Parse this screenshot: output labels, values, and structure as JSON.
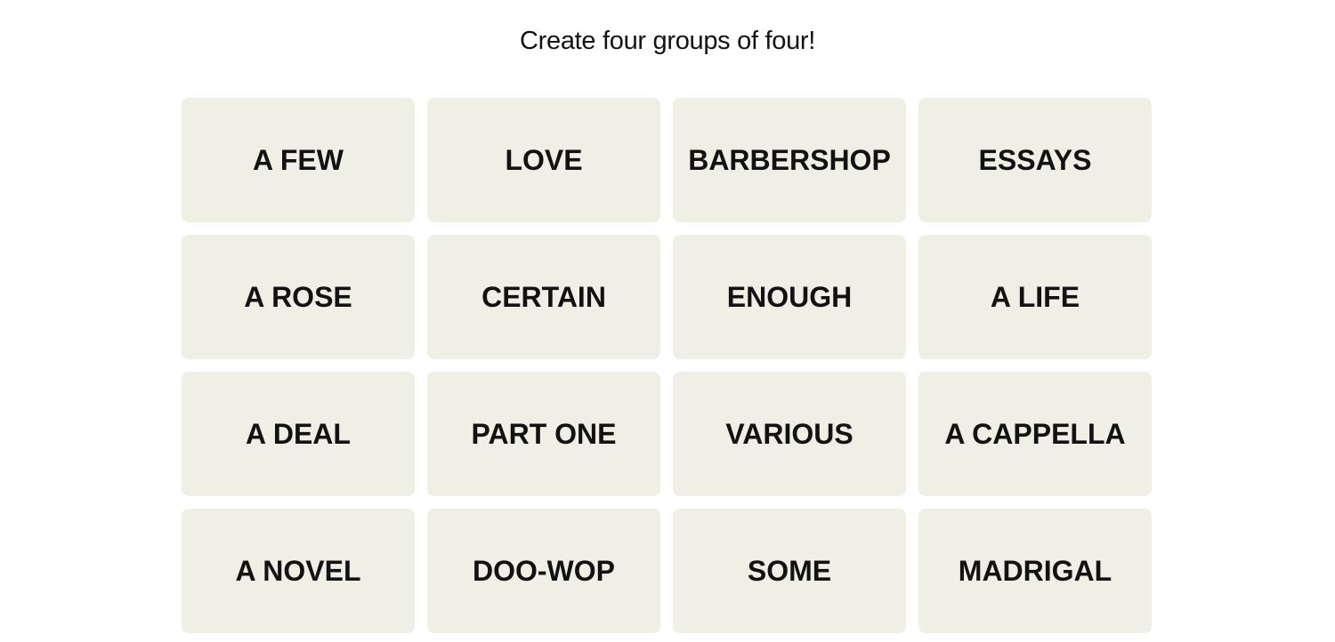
{
  "header": {
    "instruction": "Create four groups of four!"
  },
  "board": {
    "tiles": [
      "A FEW",
      "LOVE",
      "BARBERSHOP",
      "ESSAYS",
      "A ROSE",
      "CERTAIN",
      "ENOUGH",
      "A LIFE",
      "A DEAL",
      "PART ONE",
      "VARIOUS",
      "A CAPPELLA",
      "A NOVEL",
      "DOO-WOP",
      "SOME",
      "MADRIGAL"
    ]
  }
}
